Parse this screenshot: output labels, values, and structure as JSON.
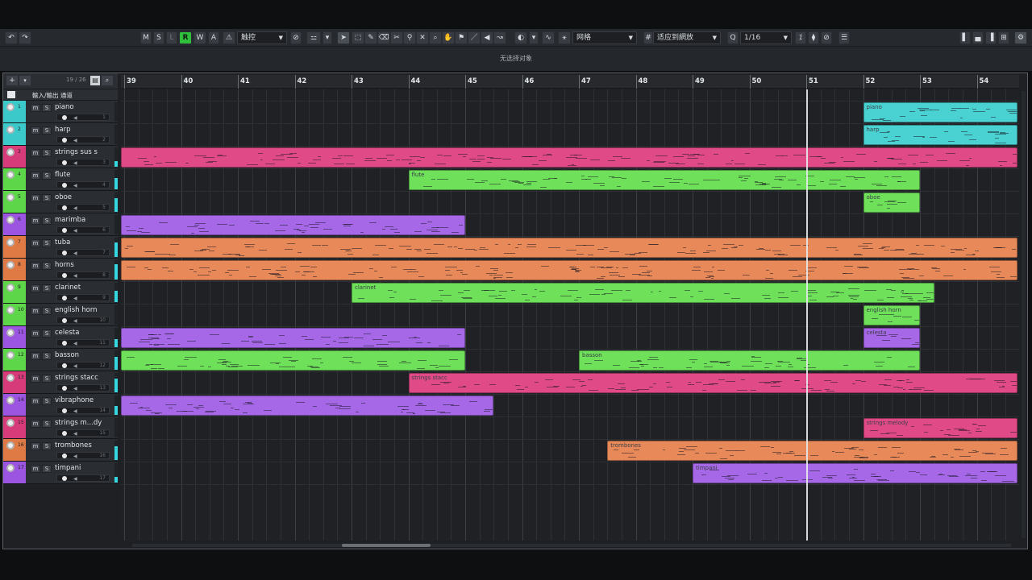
{
  "toolbar": {
    "undo_icon": "undo-icon",
    "redo_icon": "redo-icon",
    "m": "M",
    "s": "S",
    "l": "L",
    "r": "R",
    "w": "W",
    "a": "A",
    "automation_mode": "触控",
    "grid_type": "网格",
    "quantize_mode": "适应到網放",
    "quantize_value": "1/16"
  },
  "status": {
    "message": "无选择对象"
  },
  "track_header": {
    "count": "19 / 26",
    "io_label": "輸入/輸出 通道"
  },
  "ruler": {
    "bars": [
      "39",
      "40",
      "41",
      "42",
      "43",
      "44",
      "45",
      "46",
      "47",
      "48",
      "49",
      "50",
      "51",
      "52",
      "53",
      "54"
    ]
  },
  "tracks": [
    {
      "n": "1",
      "name": "piano",
      "color": "#3cc9c9"
    },
    {
      "n": "2",
      "name": "harp",
      "color": "#3cc9c9"
    },
    {
      "n": "3",
      "name": "strings sus s",
      "color": "#d83b79"
    },
    {
      "n": "4",
      "name": "flute",
      "color": "#5ed64a"
    },
    {
      "n": "5",
      "name": "oboe",
      "color": "#5ed64a"
    },
    {
      "n": "6",
      "name": "marimba",
      "color": "#9b55e0"
    },
    {
      "n": "7",
      "name": "tuba",
      "color": "#e07a45"
    },
    {
      "n": "8",
      "name": "horns",
      "color": "#e07a45"
    },
    {
      "n": "9",
      "name": "clarinet",
      "color": "#5ed64a"
    },
    {
      "n": "10",
      "name": "english horn",
      "color": "#5ed64a"
    },
    {
      "n": "11",
      "name": "celesta",
      "color": "#9b55e0"
    },
    {
      "n": "12",
      "name": "basson",
      "color": "#5ed64a"
    },
    {
      "n": "13",
      "name": "strings stacc",
      "color": "#d83b79"
    },
    {
      "n": "14",
      "name": "vibraphone",
      "color": "#9b55e0"
    },
    {
      "n": "15",
      "name": "strings m...dy",
      "color": "#d83b79"
    },
    {
      "n": "16",
      "name": "trombones",
      "color": "#e07a45"
    },
    {
      "n": "17",
      "name": "timpani",
      "color": "#9b55e0"
    }
  ],
  "parts": [
    {
      "track": 0,
      "start": 52,
      "end": 55.7,
      "label": "piano",
      "color": "#4ad2d2"
    },
    {
      "track": 1,
      "start": 52,
      "end": 55.7,
      "label": "harp",
      "color": "#4ad2d2"
    },
    {
      "track": 2,
      "start": 38.95,
      "end": 55.7,
      "label": "",
      "color": "#e04a86"
    },
    {
      "track": 3,
      "start": 44,
      "end": 53,
      "label": "flute",
      "color": "#6ee05a"
    },
    {
      "track": 4,
      "start": 52,
      "end": 53,
      "label": "oboe",
      "color": "#6ee05a"
    },
    {
      "track": 5,
      "start": 38.95,
      "end": 45,
      "label": "",
      "color": "#a668e6"
    },
    {
      "track": 6,
      "start": 38.95,
      "end": 55.7,
      "label": "",
      "color": "#e8895a"
    },
    {
      "track": 7,
      "start": 38.95,
      "end": 55.7,
      "label": "",
      "color": "#e8895a"
    },
    {
      "track": 8,
      "start": 43,
      "end": 53.25,
      "label": "clarinet",
      "color": "#6ee05a"
    },
    {
      "track": 9,
      "start": 52,
      "end": 53,
      "label": "english horn",
      "color": "#6ee05a"
    },
    {
      "track": 10,
      "start": 38.95,
      "end": 45,
      "label": "",
      "color": "#a668e6"
    },
    {
      "track": 10,
      "start": 52,
      "end": 53,
      "label": "celesta",
      "color": "#a668e6"
    },
    {
      "track": 11,
      "start": 38.95,
      "end": 45,
      "label": "",
      "color": "#6ee05a"
    },
    {
      "track": 11,
      "start": 47,
      "end": 53,
      "label": "basson",
      "color": "#6ee05a"
    },
    {
      "track": 12,
      "start": 44,
      "end": 55.7,
      "label": "strings stacc",
      "color": "#e04a86"
    },
    {
      "track": 13,
      "start": 38.95,
      "end": 45.5,
      "label": "",
      "color": "#a668e6"
    },
    {
      "track": 14,
      "start": 52,
      "end": 55.7,
      "label": "strings melody",
      "color": "#e04a86"
    },
    {
      "track": 15,
      "start": 47.5,
      "end": 55.7,
      "label": "trombones",
      "color": "#e8895a"
    },
    {
      "track": 16,
      "start": 49,
      "end": 55.7,
      "label": "timpani",
      "color": "#a668e6"
    }
  ],
  "playhead_bar": 51
}
